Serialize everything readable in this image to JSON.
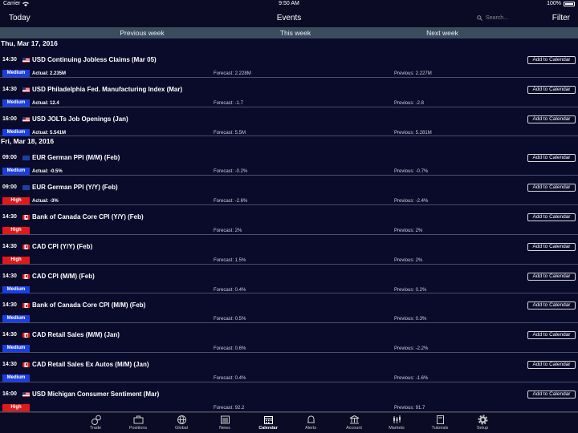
{
  "status_bar": {
    "carrier": "Carrier",
    "time": "9:50 AM",
    "battery": "100%"
  },
  "nav": {
    "left": "Today",
    "title": "Events",
    "search_placeholder": "Search...",
    "right": "Filter"
  },
  "week_tabs": [
    "Previous week",
    "This week",
    "Next week"
  ],
  "add_label": "Add to Calendar",
  "groups": [
    {
      "date": "Thu, Mar 17, 2016",
      "events": [
        {
          "time": "14:30",
          "flag": "us-flag-icon",
          "name": "USD Continuing Jobless Claims (Mar 05)",
          "impact": "Medium",
          "actual": "Actual: 2.235M",
          "forecast": "Forecast: 2.228M",
          "previous": "Previous: 2.227M"
        },
        {
          "time": "14:30",
          "flag": "us-flag-icon",
          "name": "USD Philadelphia Fed. Manufacturing Index (Mar)",
          "impact": "Medium",
          "actual": "Actual: 12.4",
          "forecast": "Forecast: -1.7",
          "previous": "Previous: -2.8"
        },
        {
          "time": "16:00",
          "flag": "us-flag-icon",
          "name": "USD JOLTs Job Openings (Jan)",
          "impact": "Medium",
          "actual": "Actual: 5.541M",
          "forecast": "Forecast: 5.5M",
          "previous": "Previous: 5.281M"
        }
      ]
    },
    {
      "date": "Fri, Mar 18, 2016",
      "events": [
        {
          "time": "09:00",
          "flag": "eu-flag-icon",
          "name": "EUR German PPI (M/M) (Feb)",
          "impact": "Medium",
          "actual": "Actual: -0.5%",
          "forecast": "Forecast: -0.2%",
          "previous": "Previous: -0.7%"
        },
        {
          "time": "09:00",
          "flag": "eu-flag-icon",
          "name": "EUR German PPI (Y/Y) (Feb)",
          "impact": "High",
          "actual": "Actual: -3%",
          "forecast": "Forecast: -2.6%",
          "previous": "Previous: -2.4%"
        },
        {
          "time": "14:30",
          "flag": "ca-flag-icon",
          "name": "Bank of Canada Core CPI (Y/Y) (Feb)",
          "impact": "High",
          "actual": "",
          "forecast": "Forecast: 2%",
          "previous": "Previous: 2%"
        },
        {
          "time": "14:30",
          "flag": "ca-flag-icon",
          "name": "CAD CPI (Y/Y) (Feb)",
          "impact": "High",
          "actual": "",
          "forecast": "Forecast: 1.5%",
          "previous": "Previous: 2%"
        },
        {
          "time": "14:30",
          "flag": "ca-flag-icon",
          "name": "CAD CPI (M/M) (Feb)",
          "impact": "Medium",
          "actual": "",
          "forecast": "Forecast: 0.4%",
          "previous": "Previous: 0.2%"
        },
        {
          "time": "14:30",
          "flag": "ca-flag-icon",
          "name": "Bank of Canada Core CPI (M/M) (Feb)",
          "impact": "Medium",
          "actual": "",
          "forecast": "Forecast: 0.5%",
          "previous": "Previous: 0.3%"
        },
        {
          "time": "14:30",
          "flag": "ca-flag-icon",
          "name": "CAD Retail Sales (M/M) (Jan)",
          "impact": "Medium",
          "actual": "",
          "forecast": "Forecast: 0.6%",
          "previous": "Previous: -2.2%"
        },
        {
          "time": "14:30",
          "flag": "ca-flag-icon",
          "name": "CAD Retail Sales Ex Autos (M/M) (Jan)",
          "impact": "Medium",
          "actual": "",
          "forecast": "Forecast: 0.4%",
          "previous": "Previous: -1.6%"
        },
        {
          "time": "16:00",
          "flag": "us-flag-icon",
          "name": "USD Michigan Consumer Sentiment (Mar)",
          "impact": "High",
          "actual": "",
          "forecast": "Forecast: 92.2",
          "previous": "Previous: 91.7"
        }
      ]
    }
  ],
  "tabs": [
    {
      "label": "Trade",
      "icon": "trade-icon"
    },
    {
      "label": "Positions",
      "icon": "briefcase-icon"
    },
    {
      "label": "Global",
      "icon": "globe-icon"
    },
    {
      "label": "News",
      "icon": "newspaper-icon"
    },
    {
      "label": "Calendar",
      "icon": "calendar-icon",
      "active": true
    },
    {
      "label": "Alerts",
      "icon": "bell-icon"
    },
    {
      "label": "Account",
      "icon": "bank-icon"
    },
    {
      "label": "Markets",
      "icon": "chart-icon"
    },
    {
      "label": "Tutorials",
      "icon": "book-icon"
    },
    {
      "label": "Setup",
      "icon": "gear-icon"
    }
  ]
}
